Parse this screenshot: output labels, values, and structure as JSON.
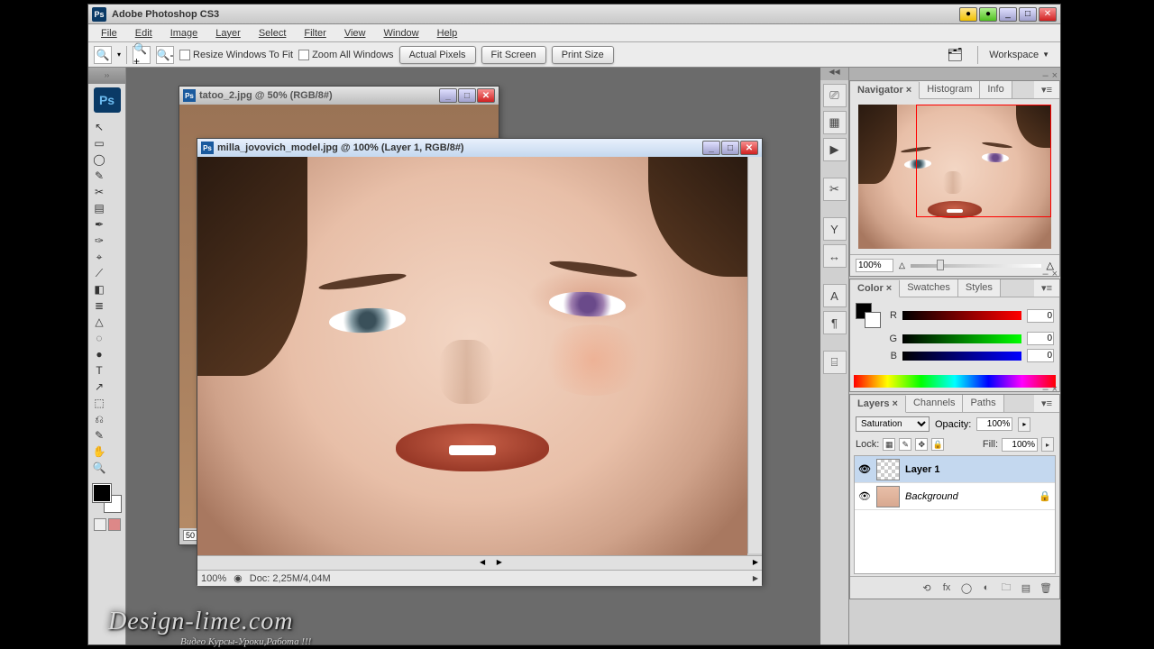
{
  "app": {
    "title": "Adobe Photoshop CS3"
  },
  "menu": [
    "File",
    "Edit",
    "Image",
    "Layer",
    "Select",
    "Filter",
    "View",
    "Window",
    "Help"
  ],
  "options": {
    "resize_label": "Resize Windows To Fit",
    "zoom_all_label": "Zoom All Windows",
    "actual_pixels": "Actual Pixels",
    "fit_screen": "Fit Screen",
    "print_size": "Print Size",
    "workspace_label": "Workspace"
  },
  "documents": {
    "back": {
      "title": "tatoo_2.jpg @ 50% (RGB/8#)",
      "ruler50": "50"
    },
    "front": {
      "title": "milla_jovovich_model.jpg @ 100% (Layer 1, RGB/8#)",
      "zoom": "100%",
      "doc_size": "Doc: 2,25M/4,04M"
    }
  },
  "panel_strip_icons": [
    "⎚",
    "▦",
    "▶",
    "✂",
    "Y",
    "↔",
    "A",
    "¶",
    "⌸"
  ],
  "navigator": {
    "tabs": [
      "Navigator",
      "Histogram",
      "Info"
    ],
    "zoom": "100%"
  },
  "color": {
    "tabs": [
      "Color",
      "Swatches",
      "Styles"
    ],
    "r": "0",
    "g": "0",
    "b": "0"
  },
  "layers": {
    "tabs": [
      "Layers",
      "Channels",
      "Paths"
    ],
    "blend_mode": "Saturation",
    "opacity_label": "Opacity:",
    "opacity": "100%",
    "fill_label": "Fill:",
    "fill": "100%",
    "lock_label": "Lock:",
    "items": [
      {
        "name": "Layer 1",
        "selected": true,
        "locked": false
      },
      {
        "name": "Background",
        "selected": false,
        "locked": true
      }
    ]
  },
  "watermark": {
    "main": "Design-lime.com",
    "sub": "Видео Курсы-Уроки,Работа !!!"
  },
  "tool_icons": [
    "↖",
    "▭",
    "◯",
    "✎",
    "✂",
    "▤",
    "✒",
    "✑",
    "⌖",
    "⟋",
    "◧",
    "≣",
    "△",
    "◌",
    "●",
    "⎌",
    "✎",
    "T",
    "↗",
    "⬚",
    "✋",
    "🔍"
  ]
}
